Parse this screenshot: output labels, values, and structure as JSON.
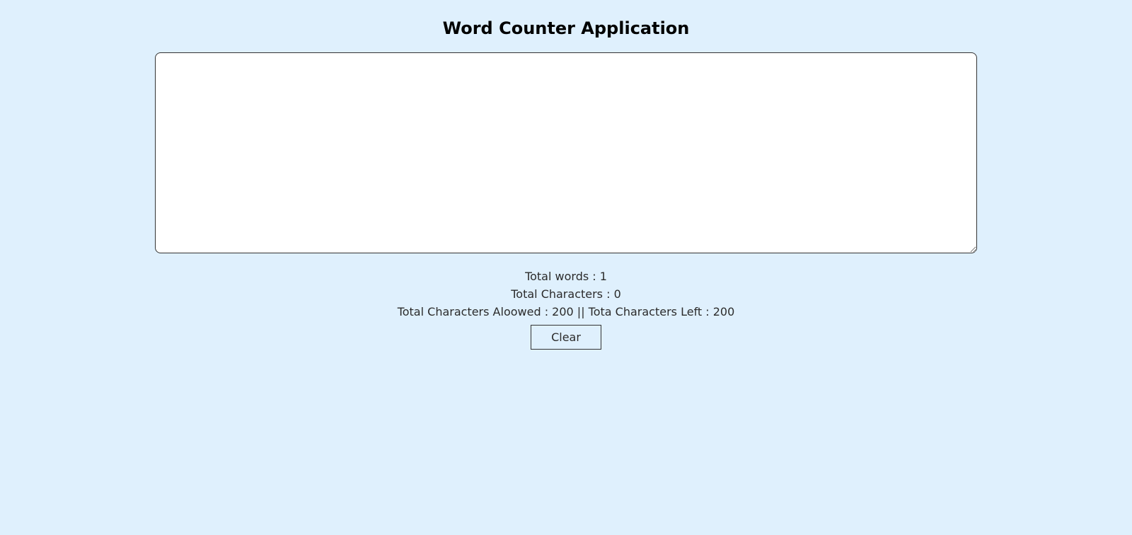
{
  "header": {
    "title": "Word Counter Application"
  },
  "editor": {
    "value": "",
    "placeholder": ""
  },
  "stats": {
    "words_label": "Total words : 1",
    "chars_label": "Total Characters : 0",
    "limit_label": "Total Characters Aloowed : 200 || Tota Characters Left : 200"
  },
  "actions": {
    "clear_label": "Clear"
  },
  "colors": {
    "background": "#dff0fd",
    "editor_background": "#ffffff",
    "border": "#333333"
  }
}
